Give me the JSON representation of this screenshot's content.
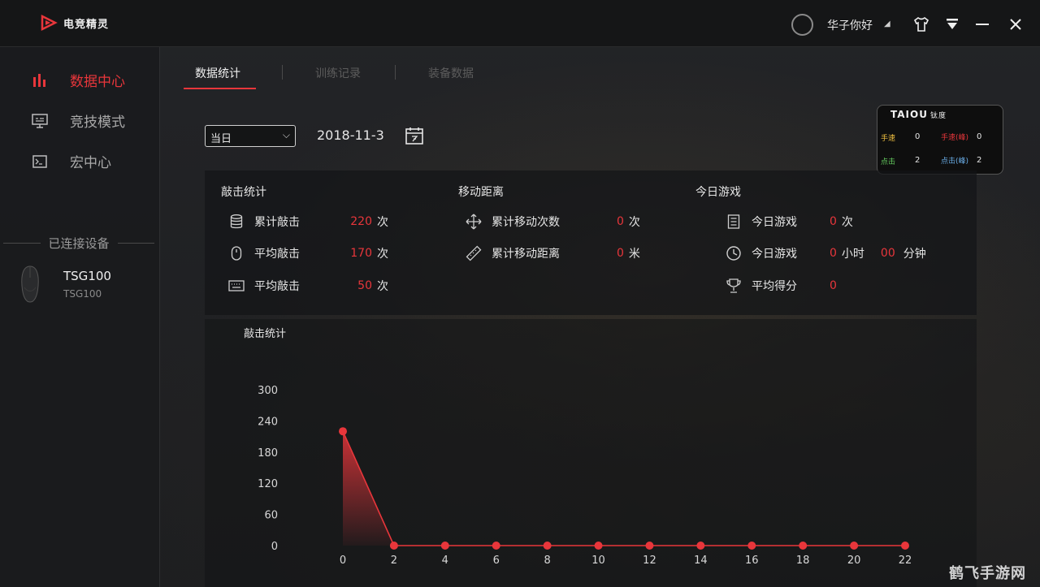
{
  "app": {
    "logo_text": "电竞精灵",
    "user_name": "华子你好",
    "accent": "#e8363b"
  },
  "titlebar": {
    "icons": [
      "user-avatar",
      "shirt-icon",
      "download-icon",
      "minimize-icon",
      "close-icon"
    ]
  },
  "sidebar": {
    "items": [
      {
        "label": "数据中心",
        "icon": "bar-chart-icon",
        "active": true
      },
      {
        "label": "竞技模式",
        "icon": "monitor-icon",
        "active": false
      },
      {
        "label": "宏中心",
        "icon": "terminal-icon",
        "active": false
      }
    ],
    "devices_heading": "已连接设备",
    "device": {
      "name": "TSG100",
      "model": "TSG100",
      "icon": "mouse-icon"
    }
  },
  "tabs": [
    {
      "label": "数据统计",
      "active": true
    },
    {
      "label": "训练记录",
      "active": false
    },
    {
      "label": "装备数据",
      "active": false
    }
  ],
  "filter": {
    "period": "当日",
    "date": "2018-11-3"
  },
  "overlay": {
    "brand": "TAIOU",
    "brand_cn": "钛度",
    "rows": [
      {
        "left_label": "手速",
        "left_val": "0",
        "right_label": "手速(峰)",
        "right_val": "0"
      },
      {
        "left_label": "点击",
        "left_val": "2",
        "right_label": "点击(峰)",
        "right_val": "2"
      }
    ]
  },
  "stats": {
    "clicks": {
      "heading": "敲击统计",
      "rows": [
        {
          "label": "累计敲击",
          "value": "220",
          "unit": "次",
          "icon": "database-icon"
        },
        {
          "label": "平均敲击",
          "value": "170",
          "unit": "次",
          "icon": "mouse-icon"
        },
        {
          "label": "平均敲击",
          "value": "50",
          "unit": "次",
          "icon": "keyboard-icon"
        }
      ]
    },
    "movement": {
      "heading": "移动距离",
      "rows": [
        {
          "label": "累计移动次数",
          "value": "0",
          "unit": "次",
          "icon": "move-icon"
        },
        {
          "label": "累计移动距离",
          "value": "0",
          "unit": "米",
          "icon": "ruler-icon"
        }
      ]
    },
    "today": {
      "heading": "今日游戏",
      "rows": [
        {
          "label": "今日游戏",
          "value": "0",
          "unit": "次",
          "icon": "list-icon"
        },
        {
          "label": "今日游戏",
          "value": "0",
          "unit": "小时",
          "value2": "00",
          "unit2": "分钟",
          "icon": "clock-icon"
        },
        {
          "label": "平均得分",
          "value": "0",
          "unit": "",
          "icon": "trophy-icon"
        }
      ]
    }
  },
  "chart_data": {
    "type": "area",
    "title": "敲击统计",
    "x": [
      0,
      2,
      4,
      6,
      8,
      10,
      12,
      14,
      16,
      18,
      20,
      22
    ],
    "series": [
      {
        "values": [
          220,
          0,
          0,
          0,
          0,
          0,
          0,
          0,
          0,
          0,
          0,
          0
        ]
      }
    ],
    "y_ticks": [
      0,
      60,
      120,
      180,
      240,
      300
    ],
    "ylim": [
      0,
      300
    ],
    "xlim": [
      0,
      22
    ],
    "grid": false,
    "color": "#e8363b"
  },
  "watermark": "鹤飞手游网"
}
